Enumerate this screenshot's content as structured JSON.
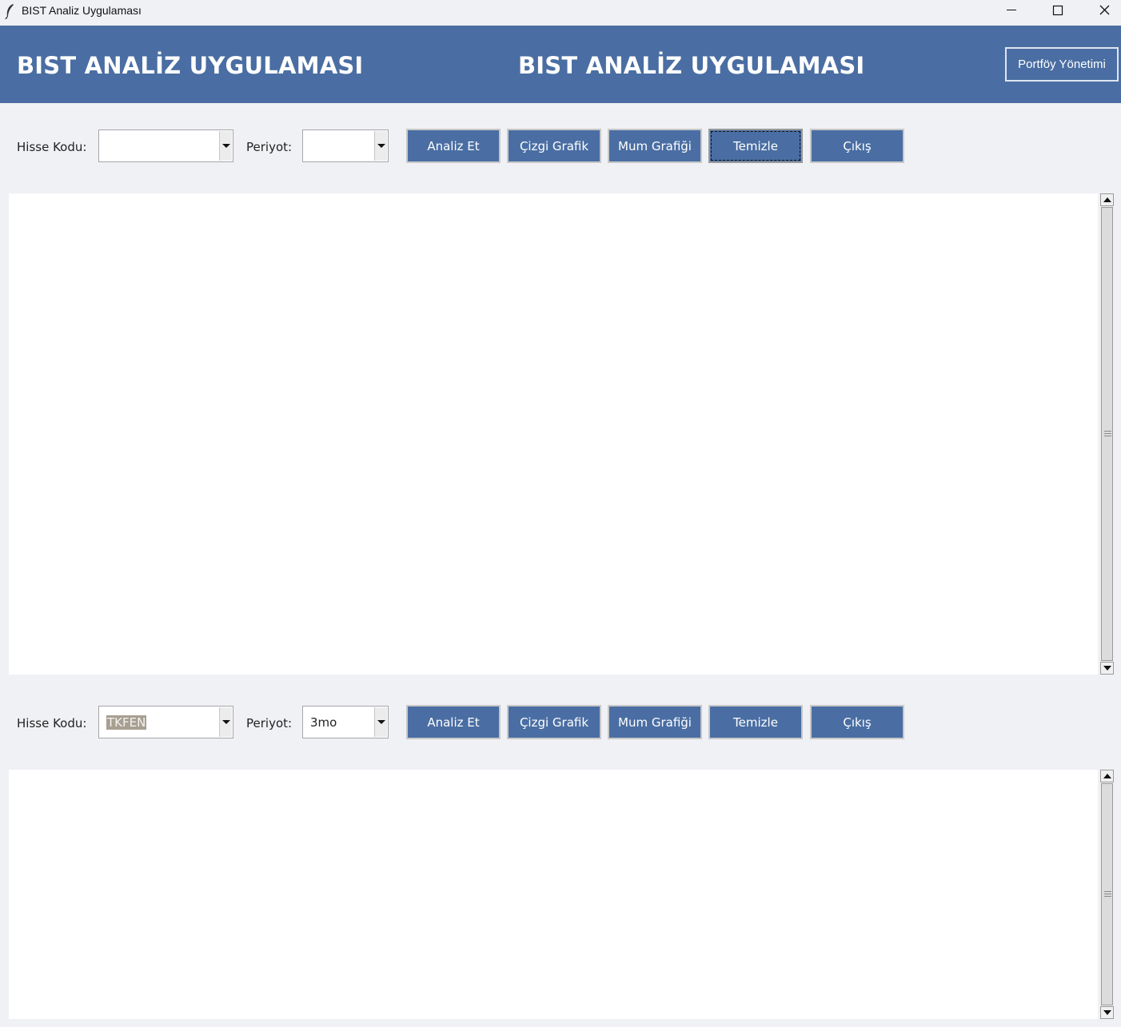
{
  "window": {
    "title": "BIST Analiz Uygulaması",
    "icon": "feather-icon"
  },
  "header": {
    "title_left": "BIST ANALİZ UYGULAMASI",
    "title_center": "BIST ANALİZ UYGULAMASI",
    "portfolio_button": "Portföy Yönetimi",
    "bg_color": "#4a6ea3"
  },
  "panels": [
    {
      "stock_label": "Hisse Kodu:",
      "stock_value": "",
      "period_label": "Periyot:",
      "period_value": "",
      "buttons": {
        "analyze": "Analiz Et",
        "line_chart": "Çizgi Grafik",
        "candle_chart": "Mum Grafiği",
        "clear": "Temizle",
        "exit": "Çıkış"
      },
      "focused_button": "clear",
      "output": ""
    },
    {
      "stock_label": "Hisse Kodu:",
      "stock_value": "TKFEN",
      "period_label": "Periyot:",
      "period_value": "3mo",
      "buttons": {
        "analyze": "Analiz Et",
        "line_chart": "Çizgi Grafik",
        "candle_chart": "Mum Grafiği",
        "clear": "Temizle",
        "exit": "Çıkış"
      },
      "focused_button": "",
      "output": ""
    }
  ]
}
